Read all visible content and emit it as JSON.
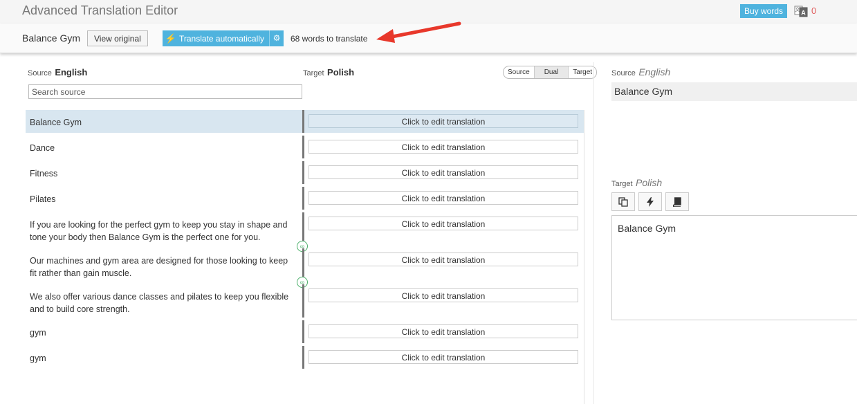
{
  "header": {
    "app_title": "Advanced Translation Editor",
    "buy_words_label": "Buy words",
    "credit_count": "0"
  },
  "toolbar": {
    "doc_title": "Balance Gym",
    "view_original_label": "View original",
    "translate_auto_label": "Translate automatically",
    "words_to_translate": "68 words to translate"
  },
  "list": {
    "source_label": "Source",
    "source_lang": "English",
    "target_label": "Target",
    "target_lang": "Polish",
    "modes": [
      "Source",
      "Dual",
      "Target"
    ],
    "selected_mode": "Dual",
    "search_placeholder": "Search source",
    "edit_placeholder": "Click to edit translation",
    "segments": [
      "Balance Gym",
      "Dance",
      "Fitness",
      "Pilates",
      "If you are looking for the perfect gym to keep you stay in shape and tone your body then Balance Gym is the perfect one for you.",
      "Our machines and gym area are designed for those looking to keep fit rather than gain muscle.",
      "We also offer various dance classes and pilates to keep you flexible and to build core strength.",
      "gym",
      "gym"
    ]
  },
  "details": {
    "source_label": "Source",
    "source_lang": "English",
    "source_text": "Balance Gym",
    "target_label": "Target",
    "target_lang": "Polish",
    "target_text": "Balance Gym"
  },
  "colors": {
    "accent": "#4fb3de",
    "active_row": "#d8e6f0",
    "credit": "#e05d5d",
    "arrow": "#e8382b",
    "link": "#4caf6a"
  }
}
